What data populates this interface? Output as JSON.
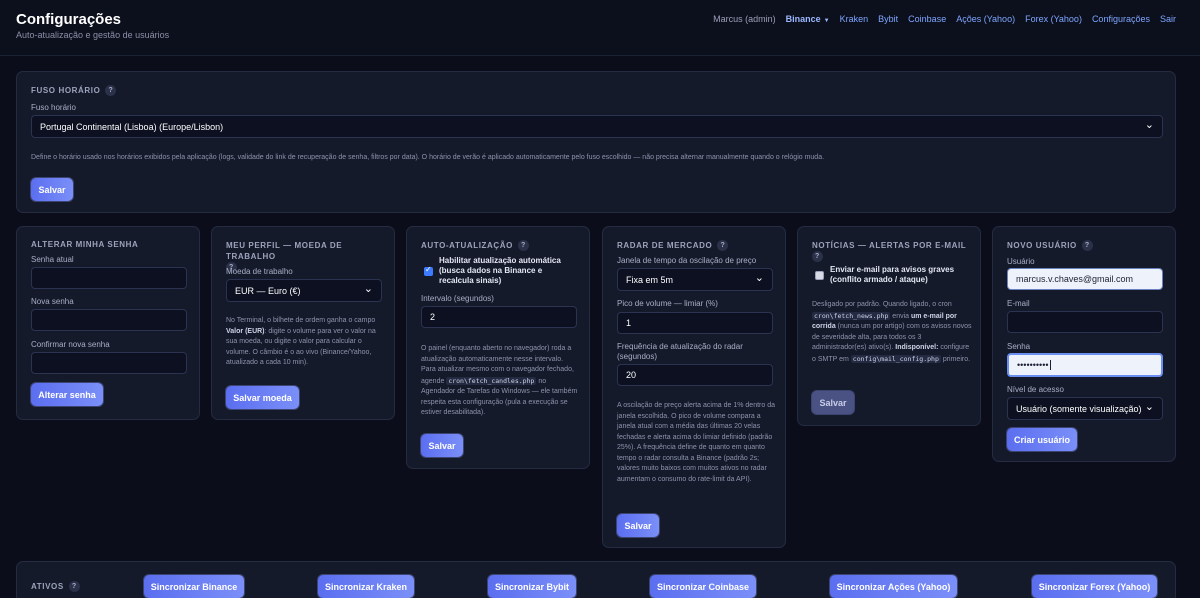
{
  "header": {
    "title": "Configurações",
    "subtitle": "Auto-atualização e gestão de usuários",
    "user": "Marcus (admin)",
    "nav": [
      "Binance",
      "Kraken",
      "Bybit",
      "Coinbase",
      "Ações (Yahoo)",
      "Forex (Yahoo)",
      "Configurações",
      "Sair"
    ]
  },
  "timezone": {
    "title": "Fuso horário",
    "help": "?",
    "label": "Fuso horário",
    "value": "Portugal Continental (Lisboa) (Europe/Lisbon)",
    "note": "Define o horário usado nos horários exibidos pela aplicação (logs, validade do link de recuperação de senha, filtros por data). O horário de verão é aplicado automaticamente pelo fuso escolhido — não precisa alternar manualmente quando o relógio muda.",
    "save": "Salvar"
  },
  "password": {
    "title": "Alterar minha senha",
    "current_label": "Senha atual",
    "new_label": "Nova senha",
    "confirm_label": "Confirmar nova senha",
    "button": "Alterar senha"
  },
  "profile": {
    "title": "Meu perfil — moeda de trabalho",
    "help": "?",
    "label": "Moeda de trabalho",
    "value": "EUR — Euro (€)",
    "note_1": "No Terminal, o bilhete de ordem ganha o campo ",
    "note_bold": "Valor (EUR)",
    "note_2": ": digite o volume para ver o valor na sua moeda, ou digite o valor para calcular o volume. O câmbio é o ao vivo (Binance/Yahoo, atualizado a cada 10 min).",
    "button": "Salvar moeda"
  },
  "autoupdate": {
    "title": "Auto-atualização",
    "help": "?",
    "checkbox_label": "Habilitar atualização automática (busca dados na Binance e recalcula sinais)",
    "interval_label": "Intervalo (segundos)",
    "interval_value": "2",
    "note_1": "O painel (enquanto aberto no navegador) roda a atualização automaticamente nesse intervalo. Para atualizar mesmo com o navegador fechado, agende ",
    "note_code": "cron\\fetch_candles.php",
    "note_2": " no Agendador de Tarefas do Windows — ele também respeita esta configuração (pula a execução se estiver desabilitada).",
    "save": "Salvar"
  },
  "radar": {
    "title": "Radar de mercado",
    "help": "?",
    "window_label": "Janela de tempo da oscilação de preço",
    "window_value": "Fixa em 5m",
    "volume_label": "Pico de volume — limiar (%)",
    "volume_value": "1",
    "freq_label": "Frequência de atualização do radar (segundos)",
    "freq_value": "20",
    "note": "A oscilação de preço alerta acima de 1% dentro da janela escolhida. O pico de volume compara a janela atual com a média das últimas 20 velas fechadas e alerta acima do limiar definido (padrão 25%). A frequência define de quanto em quanto tempo o radar consulta a Binance (padrão 2s; valores muito baixos com muitos ativos no radar aumentam o consumo do rate-limit da API).",
    "save": "Salvar"
  },
  "news": {
    "title": "Notícias — alertas por e-mail",
    "help": "?",
    "checkbox_label": "Enviar e-mail para avisos graves (conflito armado / ataque)",
    "note_1": "Desligado por padrão. Quando ligado, o cron ",
    "note_code_1": "cron\\fetch_news.php",
    "note_2": " envia ",
    "note_bold_1": "um e-mail por corrida",
    "note_3": " (nunca um por artigo) com os avisos novos de severidade alta, para todos os 3 administrador(es) ativo(s). ",
    "note_bold_2": "Indisponível:",
    "note_4": " configure o SMTP em ",
    "note_code_2": "config\\mail_config.php",
    "note_5": " primeiro.",
    "save": "Salvar"
  },
  "newuser": {
    "title": "Novo usuário",
    "help": "?",
    "user_label": "Usuário",
    "user_value": "marcus.v.chaves@gmail.com",
    "email_label": "E-mail",
    "password_label": "Senha",
    "password_value": "••••••••••",
    "level_label": "Nível de acesso",
    "level_value": "Usuário (somente visualização)",
    "button": "Criar usuário"
  },
  "assets": {
    "title": "Ativos",
    "help": "?",
    "buttons": [
      "Sincronizar Binance",
      "Sincronizar Kraken",
      "Sincronizar Bybit",
      "Sincronizar Coinbase",
      "Sincronizar Ações (Yahoo)",
      "Sincronizar Forex (Yahoo)"
    ]
  },
  "colors": {
    "background": "#0b0e1a",
    "card": "#151a2b",
    "accent": "#6a7ef4",
    "link": "#7ea6ff"
  }
}
